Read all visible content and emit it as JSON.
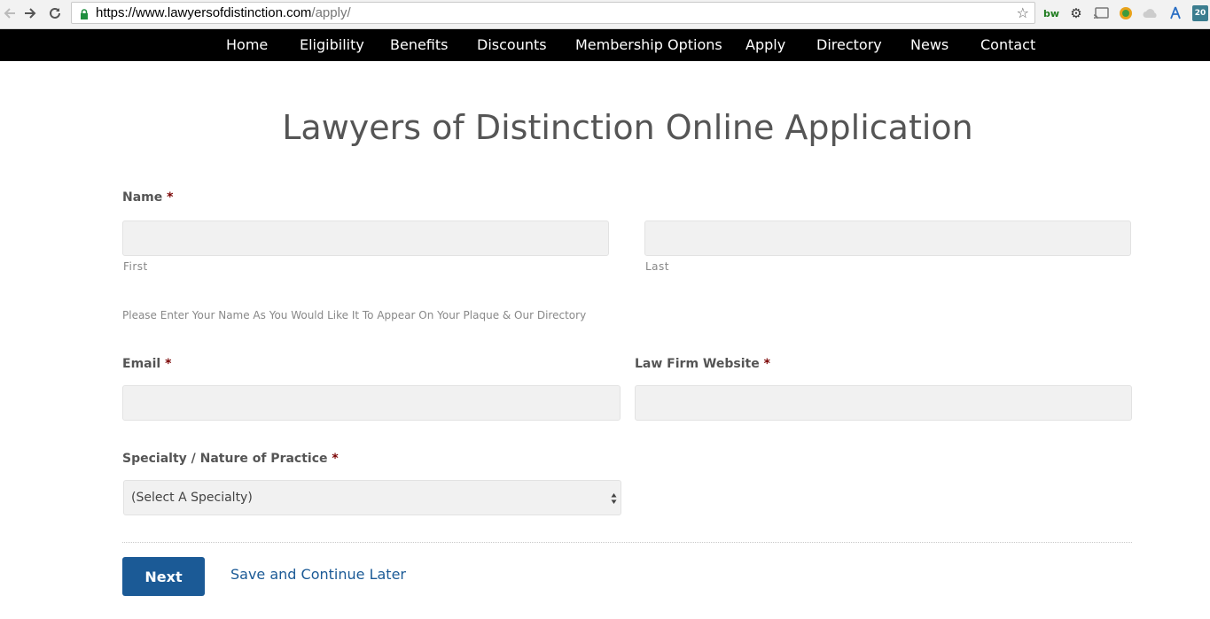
{
  "browser": {
    "url_scheme_host": "https://www.lawyersofdistinction.com",
    "url_path": "/apply/",
    "extensions": [
      "bw-icon",
      "gear-icon",
      "cast-icon",
      "badge-icon",
      "cloud-icon",
      "network-icon",
      "calendar-icon"
    ],
    "calendar_badge": "20",
    "ext_bw_label": "bw"
  },
  "nav": {
    "items": [
      "Home",
      "Eligibility",
      "Benefits",
      "Discounts",
      "Membership Options",
      "Apply",
      "Directory",
      "News",
      "Contact"
    ]
  },
  "form": {
    "title": "Lawyers of Distinction Online Application",
    "name_label": "Name",
    "required_mark": "*",
    "first_sublabel": "First",
    "last_sublabel": "Last",
    "name_hint": "Please Enter Your Name As You Would Like It To Appear On Your Plaque & Our Directory",
    "email_label": "Email",
    "website_label": "Law Firm Website",
    "specialty_label": "Specialty / Nature of Practice",
    "specialty_value": "(Select A Specialty)",
    "next_label": "Next",
    "save_label": "Save and Continue Later"
  },
  "colors": {
    "nav_bg": "#000000",
    "button_bg": "#1b5a96",
    "link": "#1b5a96",
    "required": "#790000",
    "field_bg": "#f1f1f1"
  }
}
